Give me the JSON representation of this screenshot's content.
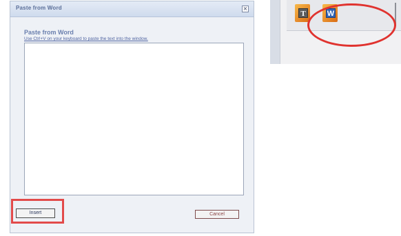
{
  "dialog": {
    "title": "Paste from Word",
    "close_symbol": "×",
    "heading": "Paste from Word",
    "instructions": "Use Ctrl+V on your keyboard to paste the text into the window.",
    "paste_value": "",
    "insert_label": "Insert",
    "cancel_label": "Cancel"
  },
  "toolbar": {
    "buttons": [
      {
        "icon": "paste-as-plain-text-icon",
        "glyph": "T"
      },
      {
        "icon": "paste-from-word-icon",
        "glyph": "W"
      }
    ]
  },
  "annotations": {
    "highlight_color": "#e0332f"
  }
}
